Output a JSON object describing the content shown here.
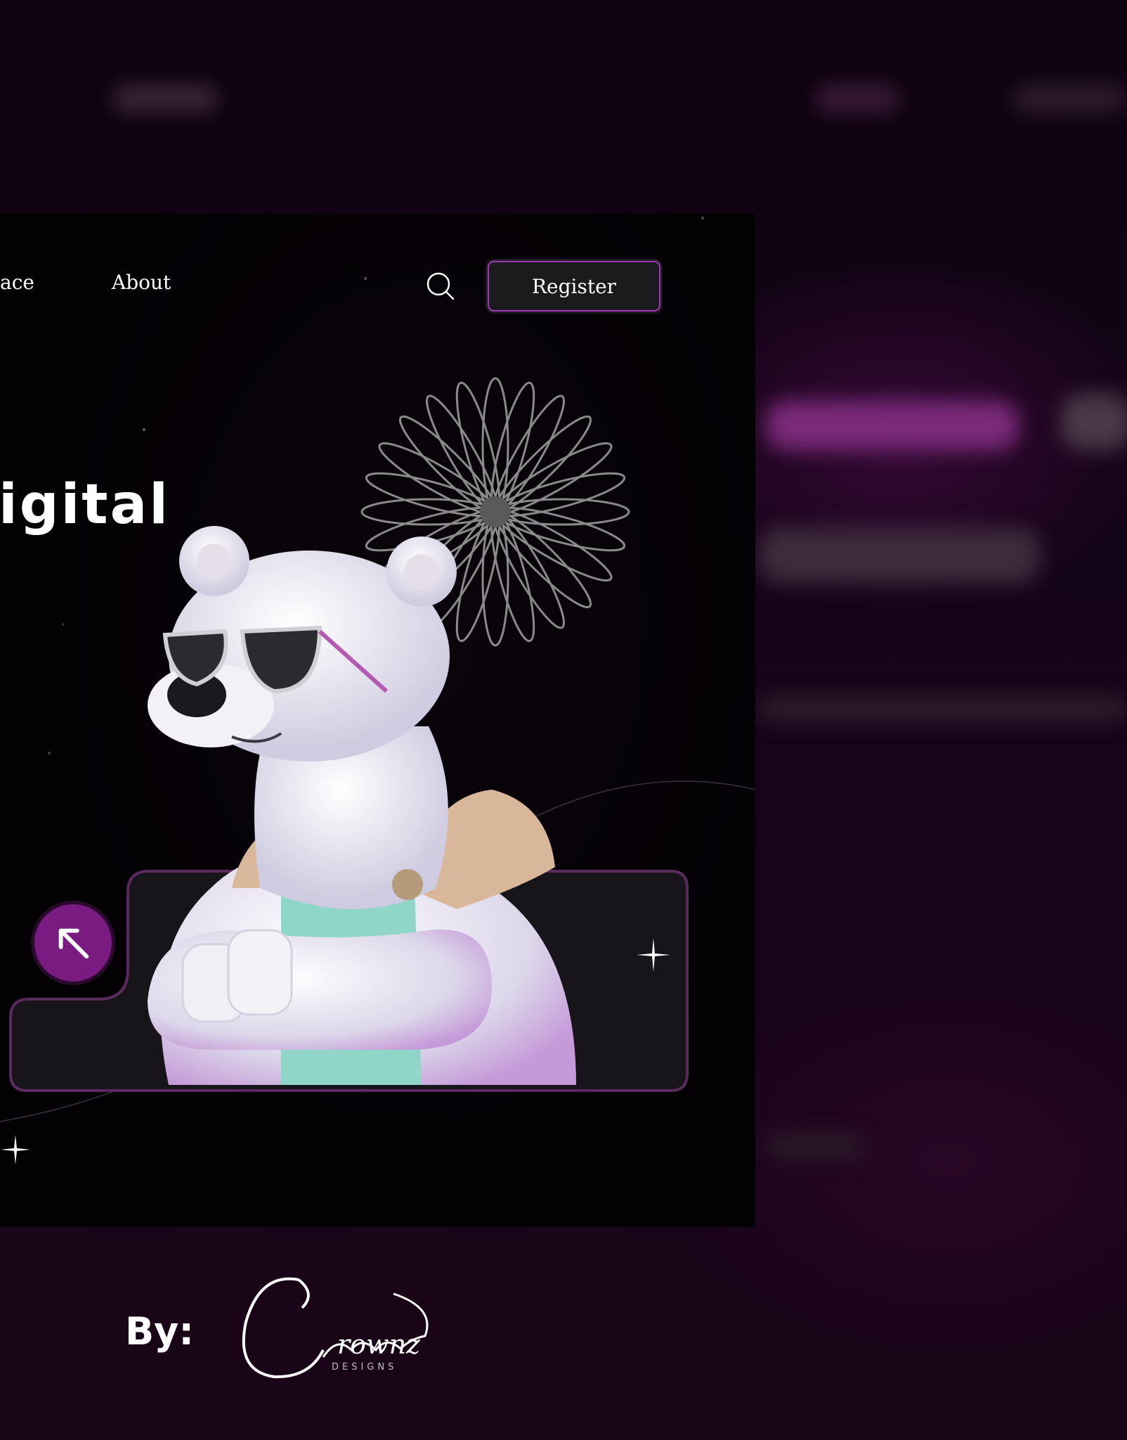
{
  "nav": {
    "links": [
      "ace",
      "About"
    ],
    "register_label": "Register"
  },
  "hero": {
    "headline": "igital"
  },
  "credit": {
    "by_label": "By:",
    "brand_name": "Crownz",
    "brand_sub": "DESIGNS"
  },
  "icons": {
    "search": "search-icon",
    "arrow": "arrow-up-left-icon",
    "sparkle": "sparkle-icon"
  },
  "colors": {
    "accent": "#7a1b82",
    "border": "#a036b8",
    "background": "#12030f"
  }
}
